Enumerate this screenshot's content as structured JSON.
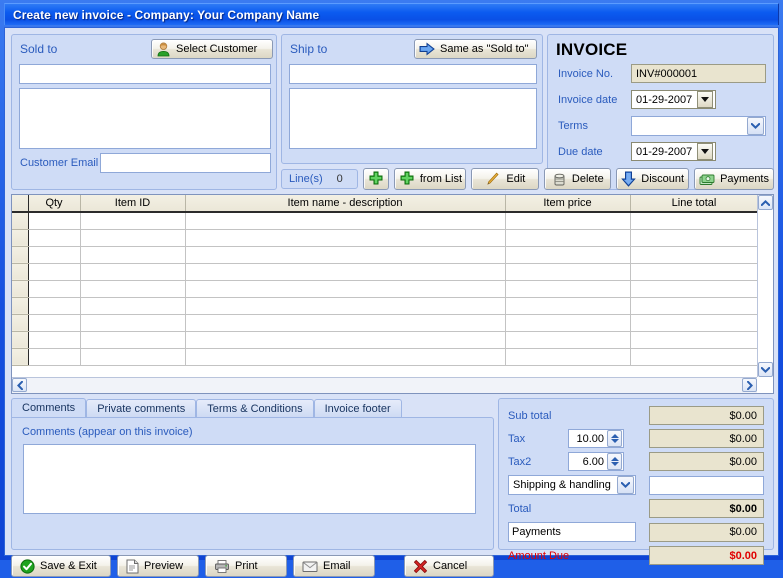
{
  "window": {
    "title": "Create new invoice - Company: Your Company Name"
  },
  "sold_to": {
    "section_label": "Sold to",
    "select_customer_button": "Select Customer",
    "select_customer_icon": "customer-person-icon",
    "name_value": "",
    "address_value": "",
    "email_label": "Customer Email",
    "email_value": ""
  },
  "ship_to": {
    "section_label": "Ship to",
    "same_as_button": "Same as \"Sold to\"",
    "same_as_icon": "blue-arrow-right-icon",
    "name_value": "",
    "address_value": ""
  },
  "invoice": {
    "heading": "INVOICE",
    "invoice_no_label": "Invoice No.",
    "invoice_no_value": "INV#000001",
    "invoice_date_label": "Invoice date",
    "invoice_date_value": "01-29-2007",
    "terms_label": "Terms",
    "terms_value": "",
    "due_date_label": "Due date",
    "due_date_value": "01-29-2007"
  },
  "toolbar": {
    "lines_label": "Line(s)",
    "lines_count": "0",
    "add_label": "",
    "add_icon": "green-plus-icon",
    "from_list_label": "from List",
    "from_list_icon": "green-plus-icon",
    "edit_label": "Edit",
    "edit_icon": "pencil-icon",
    "delete_label": "Delete",
    "delete_icon": "trash-can-icon",
    "discount_label": "Discount",
    "discount_icon": "blue-arrow-down-icon",
    "payments_label": "Payments",
    "payments_icon": "money-stack-icon"
  },
  "grid": {
    "columns": [
      "Qty",
      "Item ID",
      "Item name - description",
      "Item price",
      "Line total"
    ],
    "rows": [],
    "empty_row_count": 9,
    "scroll_up_icon": "chevron-up-icon",
    "scroll_down_icon": "chevron-down-icon",
    "scroll_left_icon": "chevron-left-icon",
    "scroll_right_icon": "chevron-right-icon"
  },
  "tabs": {
    "items": [
      {
        "label": "Comments",
        "active": true
      },
      {
        "label": "Private comments",
        "active": false
      },
      {
        "label": "Terms & Conditions",
        "active": false
      },
      {
        "label": "Invoice footer",
        "active": false
      }
    ],
    "comments_label": "Comments (appear on this invoice)",
    "comments_value": ""
  },
  "totals": {
    "sub_total_label": "Sub total",
    "sub_total_value": "$0.00",
    "tax_label": "Tax",
    "tax_rate": "10.00",
    "tax_value": "$0.00",
    "tax2_label": "Tax2",
    "tax2_rate": "6.00",
    "tax2_value": "$0.00",
    "shipping_label": "Shipping & handling",
    "shipping_value": "",
    "total_label": "Total",
    "total_value": "$0.00",
    "payments_label": "Payments",
    "payments_value": "$0.00",
    "amount_due_label": "Amount Due",
    "amount_due_value": "$0.00",
    "spinner_up_icon": "spinner-up-icon",
    "spinner_down_icon": "spinner-down-icon",
    "dropdown_icon": "chevron-down-icon"
  },
  "footer_buttons": {
    "save_exit_label": "Save & Exit",
    "save_exit_icon": "green-check-circle-icon",
    "preview_label": "Preview",
    "preview_icon": "document-icon",
    "print_label": "Print",
    "print_icon": "printer-icon",
    "email_label": "Email",
    "email_icon": "envelope-icon",
    "cancel_label": "Cancel",
    "cancel_icon": "red-x-icon"
  },
  "colors": {
    "title_bar": "#0b5bf0",
    "panel_bg": "#cfdcf6",
    "label_blue": "#2a5bbd",
    "readonly_field": "#e9e4cf",
    "amount_due_red": "#e00000",
    "accent_green": "#2fae2f"
  }
}
